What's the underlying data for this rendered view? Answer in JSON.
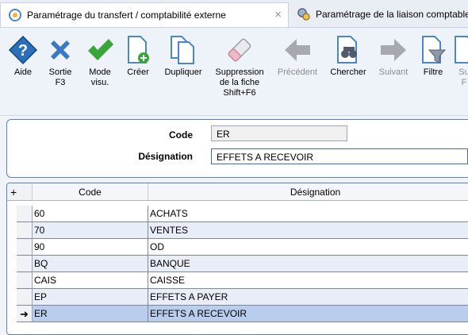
{
  "tabs": [
    {
      "label": "Paramétrage du transfert / comptabilité externe",
      "active": true,
      "close": "×"
    },
    {
      "label": "Paramétrage de la liaison comptable",
      "active": false
    }
  ],
  "toolbar": [
    {
      "id": "aide",
      "label": "Aide",
      "icon": "help-icon",
      "enabled": true
    },
    {
      "id": "sortie",
      "label": "Sortie\nF3",
      "icon": "close-icon",
      "enabled": true
    },
    {
      "id": "mode",
      "label": "Mode\nvisu.",
      "icon": "check-icon",
      "enabled": true
    },
    {
      "id": "creer",
      "label": "Créer",
      "icon": "new-document-icon",
      "enabled": true
    },
    {
      "id": "dupliquer",
      "label": "Dupliquer",
      "icon": "duplicate-icon",
      "enabled": true
    },
    {
      "id": "suppression",
      "label": "Suppression\nde la fiche\nShift+F6",
      "icon": "eraser-icon",
      "enabled": true
    },
    {
      "id": "precedent",
      "label": "Précédent",
      "icon": "arrow-left-icon",
      "enabled": false
    },
    {
      "id": "chercher",
      "label": "Chercher",
      "icon": "binoculars-icon",
      "enabled": true
    },
    {
      "id": "suivant",
      "label": "Suivant",
      "icon": "arrow-right-icon",
      "enabled": false
    },
    {
      "id": "filtre",
      "label": "Filtre",
      "icon": "filter-icon",
      "enabled": true
    },
    {
      "id": "su",
      "label": "Su\nF",
      "icon": "document-icon",
      "enabled": false
    }
  ],
  "form": {
    "code_label": "Code",
    "code_value": "ER",
    "designation_label": "Désignation",
    "designation_value": "EFFETS A RECEVOIR"
  },
  "grid": {
    "corner": "+",
    "columns": [
      "Code",
      "Désignation"
    ],
    "rows": [
      {
        "code": "60",
        "designation": "ACHATS",
        "marker": ""
      },
      {
        "code": "70",
        "designation": "VENTES",
        "marker": ""
      },
      {
        "code": "90",
        "designation": "OD",
        "marker": ""
      },
      {
        "code": "BQ",
        "designation": "BANQUE",
        "marker": ""
      },
      {
        "code": "CAIS",
        "designation": "CAISSE",
        "marker": ""
      },
      {
        "code": "EP",
        "designation": "EFFETS A PAYER",
        "marker": ""
      },
      {
        "code": "ER",
        "designation": "EFFETS A RECEVOIR",
        "marker": "➜",
        "selected": true
      }
    ]
  },
  "colors": {
    "accent": "#2f6db5",
    "help_blue": "#2a6fb8",
    "close_blue": "#3b79c4",
    "check_green": "#3aa639",
    "selected_row": "#b9cdec",
    "alt_row": "#e8edf7"
  }
}
